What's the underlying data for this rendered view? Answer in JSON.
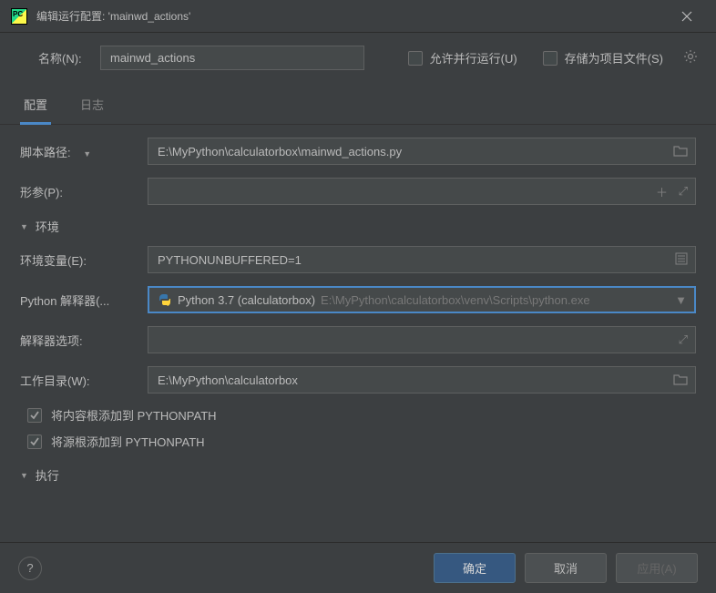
{
  "window": {
    "title": "编辑运行配置: 'mainwd_actions'"
  },
  "name": {
    "label": "名称(N):",
    "value": "mainwd_actions"
  },
  "options": {
    "parallel": "允许并行运行(U)",
    "saveProject": "存储为项目文件(S)"
  },
  "tabs": {
    "config": "配置",
    "logs": "日志"
  },
  "fields": {
    "scriptPath": {
      "label": "脚本路径:",
      "value": "E:\\MyPython\\calculatorbox\\mainwd_actions.py"
    },
    "params": {
      "label": "形参(P):",
      "value": ""
    },
    "envHeader": "环境",
    "envVars": {
      "label": "环境变量(E):",
      "value": "PYTHONUNBUFFERED=1"
    },
    "interpreter": {
      "label": "Python 解释器(...",
      "name": "Python 3.7 (calculatorbox)",
      "path": "E:\\MyPython\\calculatorbox\\venv\\Scripts\\python.exe"
    },
    "interpOptions": {
      "label": "解释器选项:",
      "value": ""
    },
    "workDir": {
      "label": "工作目录(W):",
      "value": "E:\\MyPython\\calculatorbox"
    },
    "addContentRoots": "将内容根添加到 PYTHONPATH",
    "addSourceRoots": "将源根添加到 PYTHONPATH",
    "execHeader": "执行"
  },
  "buttons": {
    "ok": "确定",
    "cancel": "取消",
    "apply": "应用(A)"
  }
}
